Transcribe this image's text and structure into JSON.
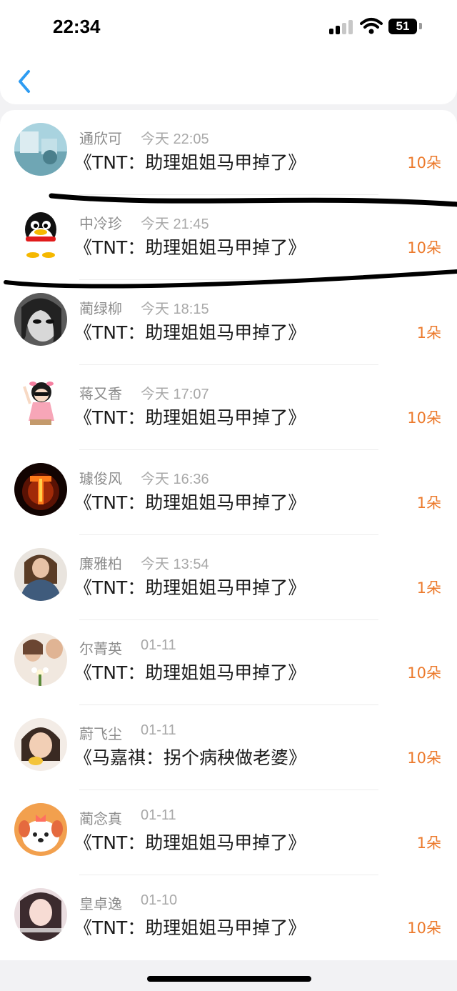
{
  "status_bar": {
    "time": "22:34",
    "battery": "51",
    "icons": [
      "signal-icon",
      "wifi-icon",
      "battery-icon"
    ]
  },
  "nav": {
    "back_icon": "chevron-left-icon",
    "accent_color": "#2e9cf2"
  },
  "colors": {
    "count": "#ec7a2c",
    "name": "#8c8c8c",
    "title": "#1c1c1c"
  },
  "list": {
    "rows": [
      {
        "name": "通欣可",
        "time": "今天 22:05",
        "title": "《TNT：助理姐姐马甲掉了》",
        "count": "10朵"
      },
      {
        "name": "中冷珍",
        "time": "今天 21:45",
        "title": "《TNT：助理姐姐马甲掉了》",
        "count": "10朵"
      },
      {
        "name": "蔺绿柳",
        "time": "今天 18:15",
        "title": "《TNT：助理姐姐马甲掉了》",
        "count": "1朵"
      },
      {
        "name": "蒋又香",
        "time": "今天 17:07",
        "title": "《TNT：助理姐姐马甲掉了》",
        "count": "10朵"
      },
      {
        "name": "璩俊风",
        "time": "今天 16:36",
        "title": "《TNT：助理姐姐马甲掉了》",
        "count": "1朵"
      },
      {
        "name": "廉雅柏",
        "time": "今天 13:54",
        "title": "《TNT：助理姐姐马甲掉了》",
        "count": "1朵"
      },
      {
        "name": "尔菁英",
        "time": "01-11",
        "title": "《TNT：助理姐姐马甲掉了》",
        "count": "10朵"
      },
      {
        "name": "蔚飞尘",
        "time": "01-11",
        "title": "《马嘉祺：拐个病秧做老婆》",
        "count": "10朵"
      },
      {
        "name": "蔺念真",
        "time": "01-11",
        "title": "《TNT：助理姐姐马甲掉了》",
        "count": "1朵"
      },
      {
        "name": "皇卓逸",
        "time": "01-10",
        "title": "《TNT：助理姐姐马甲掉了》",
        "count": "10朵"
      }
    ]
  }
}
